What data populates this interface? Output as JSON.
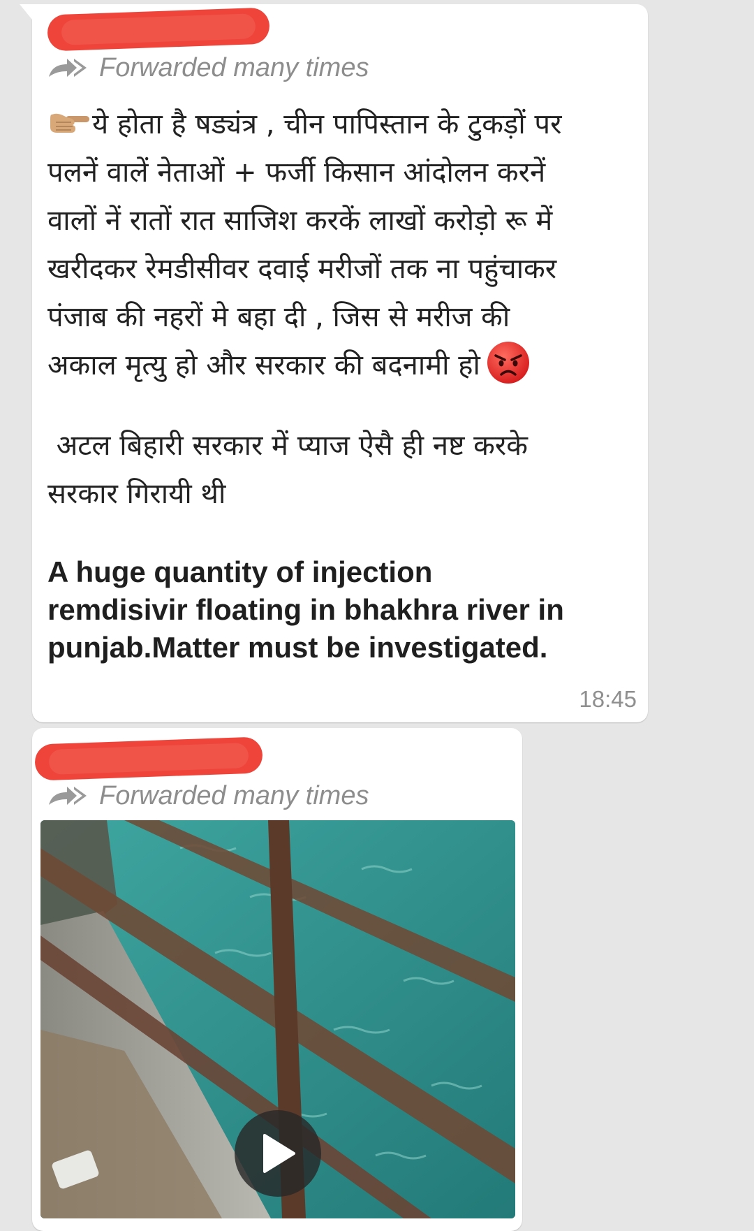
{
  "messages": [
    {
      "forwarded_label": "Forwarded many times",
      "hindi_lines": [
        "ये होता है षड्यंत्र , चीन पापिस्तान के टुकड़ों पर",
        "पलनें वालें नेताओं + फर्जी किसान आंदोलन करनें",
        "वालों नें रातों रात साजिश करकें लाखों करोड़ो रू में",
        "खरीदकर रेमडीसीवर दवाई मरीजों तक ना पहुंचाकर",
        "पंजाब की नहरों मे बहा दी , जिस से मरीज की",
        "अकाल मृत्यु हो और सरकार की बदनामी हो"
      ],
      "hindi_para2": [
        " अटल बिहारी सरकार में प्याज ऐसै ही नष्ट करके",
        "सरकार गिरायी थी"
      ],
      "english_lines": [
        "A huge quantity of injection",
        "remdisivir floating in bhakhra river in",
        "punjab.Matter must be investigated."
      ],
      "time": "18:45",
      "icons": [
        "backhand-index-pointing-right-icon",
        "angry-face-icon"
      ]
    },
    {
      "forwarded_label": "Forwarded many times",
      "media": {
        "type": "video",
        "icon": "play-icon"
      }
    }
  ],
  "colors": {
    "background": "#e6e6e6",
    "bubble": "#ffffff",
    "redaction": "#ee3a30",
    "meta_text": "#8d8d8d",
    "water": "#2e8f8b"
  }
}
